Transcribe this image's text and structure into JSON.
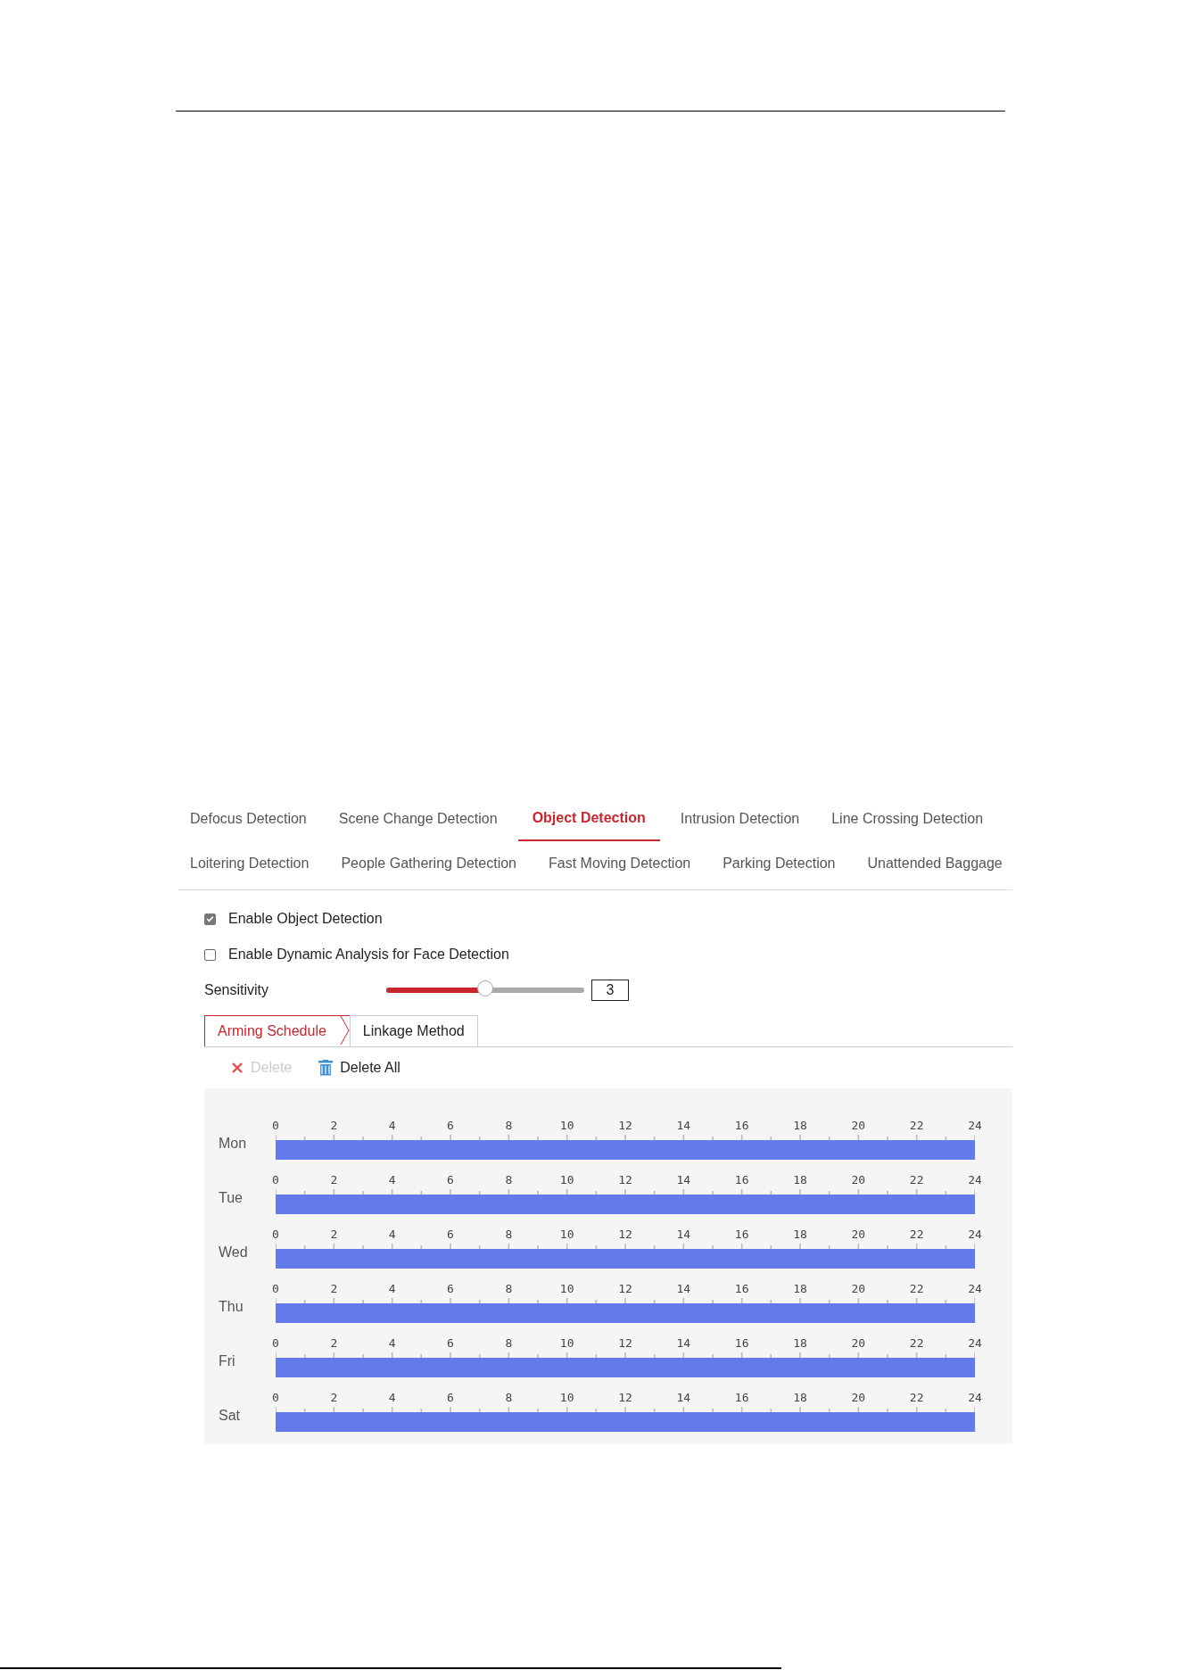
{
  "tabs": [
    [
      {
        "label": "Defocus Detection",
        "selected": false
      },
      {
        "label": "Scene Change Detection",
        "selected": false
      },
      {
        "label": "Object Detection",
        "selected": true
      },
      {
        "label": "Intrusion Detection",
        "selected": false
      },
      {
        "label": "Line Crossing Detection",
        "selected": false
      }
    ],
    [
      {
        "label": "Loitering Detection",
        "selected": false
      },
      {
        "label": "People Gathering Detection",
        "selected": false
      },
      {
        "label": "Fast Moving Detection",
        "selected": false
      },
      {
        "label": "Parking Detection",
        "selected": false
      },
      {
        "label": "Unattended Baggage",
        "selected": false
      }
    ]
  ],
  "options": [
    {
      "label": "Enable Object Detection",
      "checked": true
    },
    {
      "label": "Enable Dynamic Analysis for Face Detection",
      "checked": false
    }
  ],
  "sensitivity": {
    "label": "Sensitivity",
    "level": 0.5,
    "value": "3"
  },
  "subtabs": [
    {
      "label": "Arming Schedule",
      "selected": true
    },
    {
      "label": "Linkage Method",
      "selected": false
    }
  ],
  "toolbar": [
    {
      "label": "Delete",
      "disabled": true,
      "kind": "delete"
    },
    {
      "label": "Delete All",
      "disabled": false,
      "kind": "delete-all"
    }
  ],
  "schedule": [
    {
      "day": "Mon",
      "level": 1,
      "ticks": [
        "0",
        "2",
        "4",
        "6",
        "8",
        "10",
        "12",
        "14",
        "16",
        "18",
        "20",
        "22",
        "24"
      ]
    },
    {
      "day": "Tue",
      "level": 1,
      "ticks": [
        "0",
        "2",
        "4",
        "6",
        "8",
        "10",
        "12",
        "14",
        "16",
        "18",
        "20",
        "22",
        "24"
      ]
    },
    {
      "day": "Wed",
      "level": 1,
      "ticks": [
        "0",
        "2",
        "4",
        "6",
        "8",
        "10",
        "12",
        "14",
        "16",
        "18",
        "20",
        "22",
        "24"
      ]
    },
    {
      "day": "Thu",
      "level": 1,
      "ticks": [
        "0",
        "2",
        "4",
        "6",
        "8",
        "10",
        "12",
        "14",
        "16",
        "18",
        "20",
        "22",
        "24"
      ]
    },
    {
      "day": "Fri",
      "level": 1,
      "ticks": [
        "0",
        "2",
        "4",
        "6",
        "8",
        "10",
        "12",
        "14",
        "16",
        "18",
        "20",
        "22",
        "24"
      ]
    },
    {
      "day": "Sat",
      "level": 1,
      "ticks": [
        "0",
        "2",
        "4",
        "6",
        "8",
        "10",
        "12",
        "14",
        "16",
        "18",
        "20",
        "22",
        "24"
      ]
    }
  ]
}
